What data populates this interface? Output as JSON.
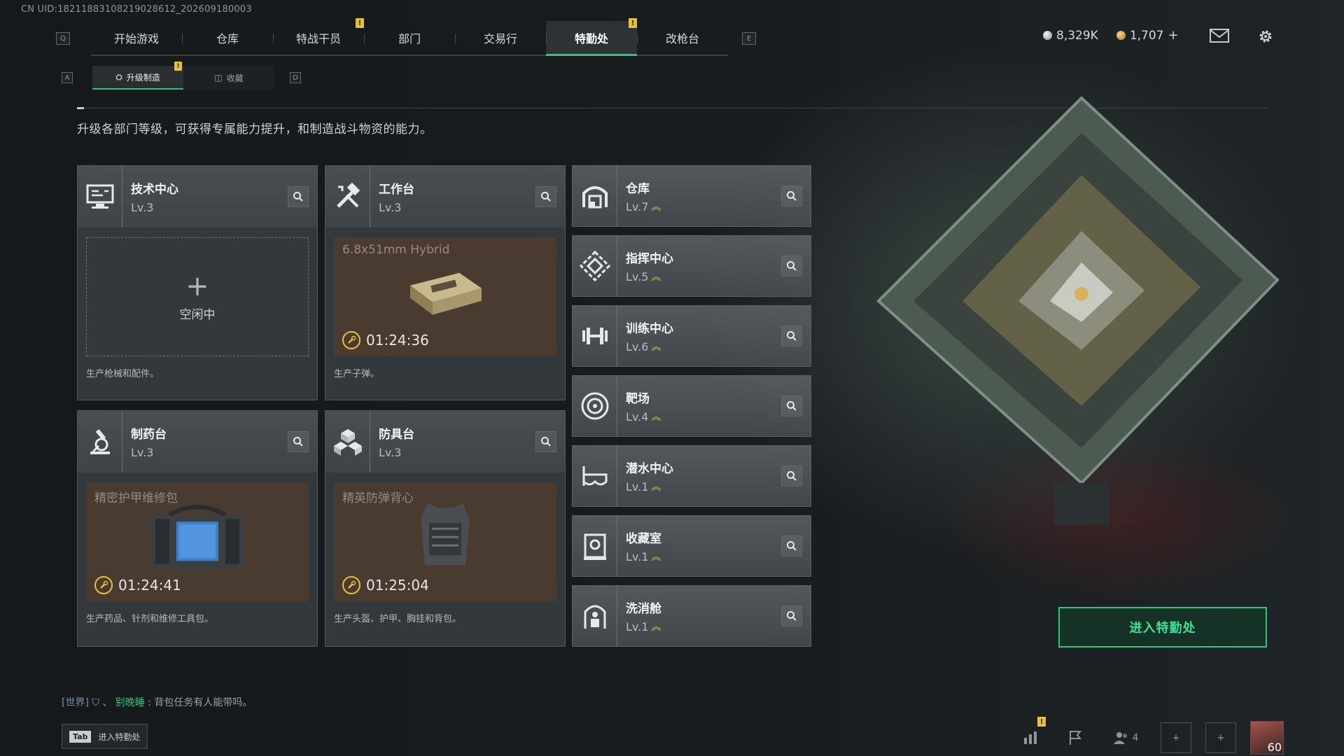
{
  "uid": "CN UID:1821188310821902861​2_202609180003",
  "top_nav": {
    "left_key": "Q",
    "right_key": "E",
    "tabs": [
      {
        "label": "开始游戏",
        "active": false,
        "alert": false
      },
      {
        "label": "仓库",
        "active": false,
        "alert": false
      },
      {
        "label": "特战干员",
        "active": false,
        "alert": true
      },
      {
        "label": "部门",
        "active": false,
        "alert": false
      },
      {
        "label": "交易行",
        "active": false,
        "alert": false
      },
      {
        "label": "特勤处",
        "active": true,
        "alert": true
      },
      {
        "label": "改枪台",
        "active": false,
        "alert": false
      }
    ],
    "alert_mark": "!"
  },
  "currency": {
    "silver": "8,329K",
    "gold": "1,707",
    "gold_plus": "+"
  },
  "sub_nav": {
    "left_key": "A",
    "right_key": "D",
    "tabs": [
      {
        "label": "升级制造",
        "active": true
      },
      {
        "label": "收藏",
        "active": false
      }
    ]
  },
  "description": "升级各部门等级，可获得专属能力提升，和制造战斗物资的能力。",
  "workshops": [
    {
      "name": "技术中心",
      "level": "Lv.3",
      "icon": "monitor-icon",
      "slot": {
        "state": "idle",
        "label": "空闲中"
      },
      "footer": "生产枪械和配件。"
    },
    {
      "name": "工作台",
      "level": "Lv.3",
      "icon": "hammer-icon",
      "slot": {
        "state": "busy",
        "item": "6.8x51mm Hybrid",
        "timer": "01:24:36"
      },
      "footer": "生产子弹。"
    },
    {
      "name": "制药台",
      "level": "Lv.3",
      "icon": "microscope-icon",
      "slot": {
        "state": "busy",
        "item": "精密护甲维修包",
        "timer": "01:24:41"
      },
      "footer": "生产药品、针剂和维修工具包。"
    },
    {
      "name": "防具台",
      "level": "Lv.3",
      "icon": "cubes-icon",
      "slot": {
        "state": "busy",
        "item": "精英防弹背心",
        "timer": "01:25:04"
      },
      "footer": "生产头盔、护甲、胸挂和背包。"
    }
  ],
  "departments": [
    {
      "name": "仓库",
      "level": "Lv.7",
      "icon": "vault-icon"
    },
    {
      "name": "指挥中心",
      "level": "Lv.5",
      "icon": "command-icon"
    },
    {
      "name": "训练中心",
      "level": "Lv.6",
      "icon": "dumbbell-icon"
    },
    {
      "name": "靶场",
      "level": "Lv.4",
      "icon": "target-icon"
    },
    {
      "name": "潜水中心",
      "level": "Lv.1",
      "icon": "diving-mask-icon"
    },
    {
      "name": "收藏室",
      "level": "Lv.1",
      "icon": "collection-icon"
    },
    {
      "name": "洗消舱",
      "level": "Lv.1",
      "icon": "decon-icon"
    }
  ],
  "enter_button": "进入特勤处",
  "chat": {
    "channel": "[世界]",
    "sep": "、",
    "name": "别晚睡",
    "message": ": 背包任务有人能带吗。"
  },
  "tab_hint": {
    "key": "Tab",
    "label": "进入特勤处"
  },
  "bottom_bar": {
    "friends_count": "4",
    "player_level": "60",
    "alert_mark": "!"
  }
}
